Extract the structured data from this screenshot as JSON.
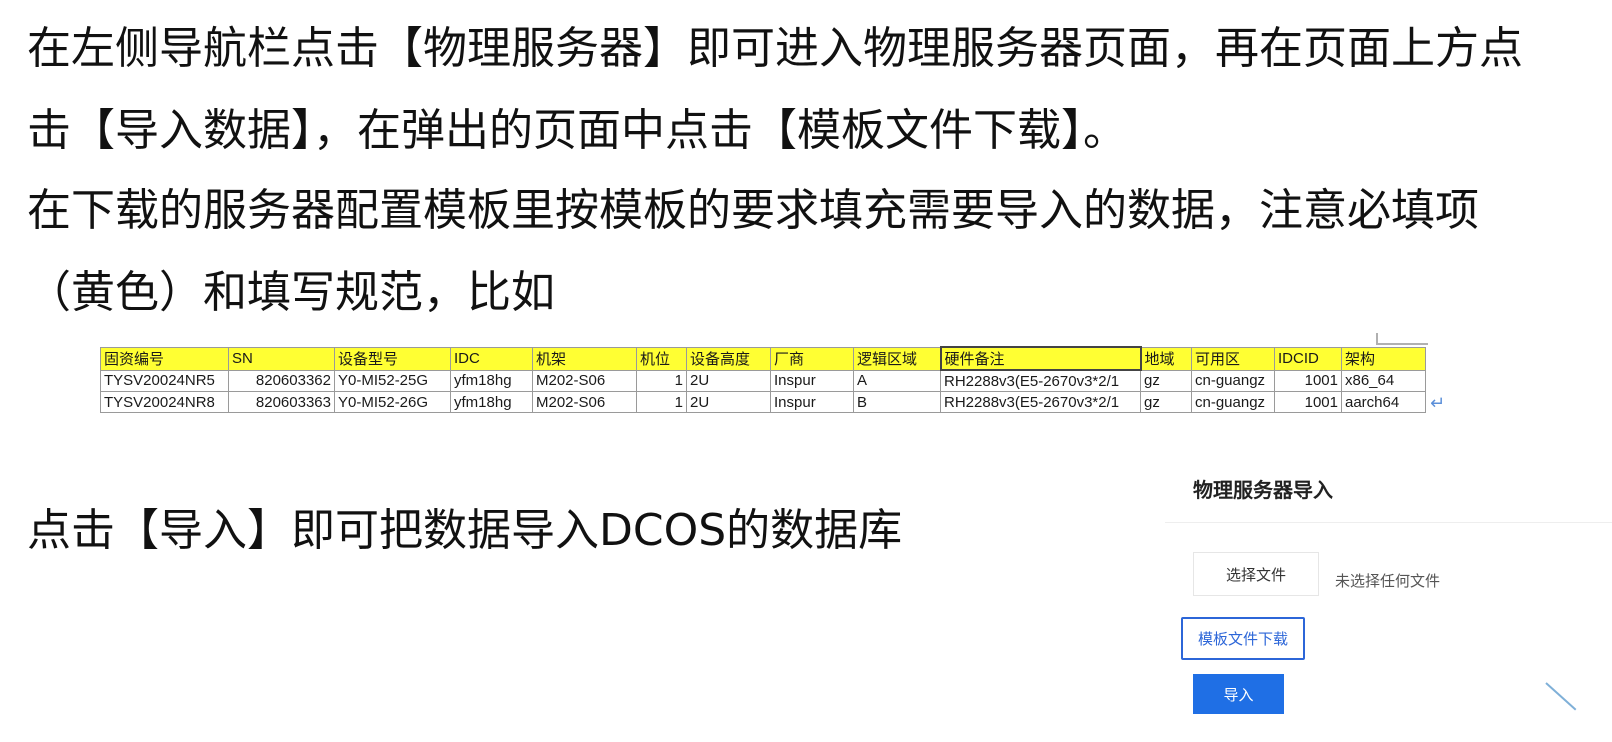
{
  "instructions": {
    "line1": "在左侧导航栏点击【物理服务器】即可进入物理服务器页面，再在页面上方点",
    "line2": "击【导入数据】，在弹出的页面中点击【模板文件下载】。",
    "line3": "在下载的服务器配置模板里按模板的要求填充需要导入的数据，注意必填项",
    "line4": "（黄色）和填写规范，比如",
    "line5": "点击【导入】即可把数据导入DCOS的数据库"
  },
  "sheet": {
    "headers": [
      "固资编号",
      "SN",
      "设备型号",
      "IDC",
      "机架",
      "机位",
      "设备高度",
      "厂商",
      "逻辑区域",
      "硬件备注",
      "地域",
      "可用区",
      "IDCID",
      "架构"
    ],
    "rows": [
      [
        "TYSV20024NR5",
        "820603362",
        "Y0-MI52-25G",
        "yfm18hg",
        "M202-S06",
        "1",
        "2U",
        "Inspur",
        "A",
        "RH2288v3(E5-2670v3*2/1",
        "gz",
        "cn-guangz",
        "1001",
        "x86_64"
      ],
      [
        "TYSV20024NR8",
        "820603363",
        "Y0-MI52-26G",
        "yfm18hg",
        "M202-S06",
        "1",
        "2U",
        "Inspur",
        "B",
        "RH2288v3(E5-2670v3*2/1",
        "gz",
        "cn-guangz",
        "1001",
        "aarch64"
      ]
    ],
    "header_color": "#ffff33"
  },
  "dialog": {
    "title": "物理服务器导入",
    "choose_file_label": "选择文件",
    "file_status": "未选择任何文件",
    "template_download_label": "模板文件下载",
    "import_label": "导入",
    "accent_color": "#1f6fe5"
  }
}
